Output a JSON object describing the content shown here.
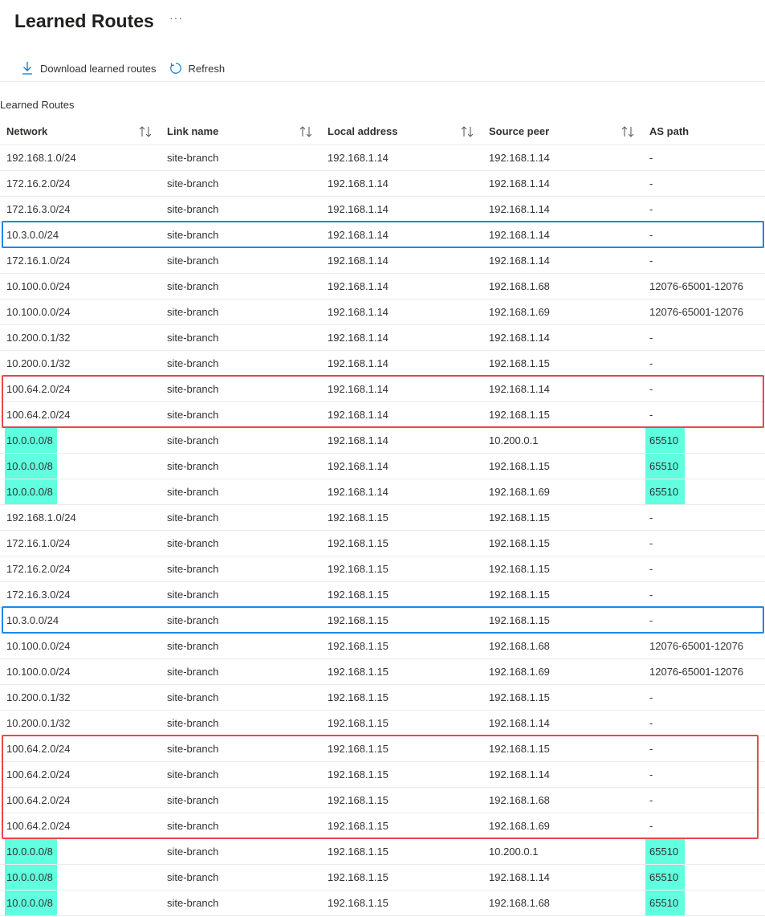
{
  "header": {
    "title": "Learned Routes",
    "more_label": "···"
  },
  "toolbar": {
    "download_label": "Download learned routes",
    "refresh_label": "Refresh"
  },
  "section_label": "Learned Routes",
  "colors": {
    "highlight": "#60ffe0",
    "blue_box": "#1e88e5",
    "red_box": "#e5484d",
    "accent": "#0078d4"
  },
  "table": {
    "columns": [
      "Network",
      "Link name",
      "Local address",
      "Source peer",
      "AS path"
    ],
    "sortable": [
      true,
      true,
      true,
      true,
      false
    ],
    "rows": [
      [
        "192.168.1.0/24",
        "site-branch",
        "192.168.1.14",
        "192.168.1.14",
        "-"
      ],
      [
        "172.16.2.0/24",
        "site-branch",
        "192.168.1.14",
        "192.168.1.14",
        "-"
      ],
      [
        "172.16.3.0/24",
        "site-branch",
        "192.168.1.14",
        "192.168.1.14",
        "-"
      ],
      [
        "10.3.0.0/24",
        "site-branch",
        "192.168.1.14",
        "192.168.1.14",
        "-"
      ],
      [
        "172.16.1.0/24",
        "site-branch",
        "192.168.1.14",
        "192.168.1.14",
        "-"
      ],
      [
        "10.100.0.0/24",
        "site-branch",
        "192.168.1.14",
        "192.168.1.68",
        "12076-65001-12076"
      ],
      [
        "10.100.0.0/24",
        "site-branch",
        "192.168.1.14",
        "192.168.1.69",
        "12076-65001-12076"
      ],
      [
        "10.200.0.1/32",
        "site-branch",
        "192.168.1.14",
        "192.168.1.14",
        "-"
      ],
      [
        "10.200.0.1/32",
        "site-branch",
        "192.168.1.14",
        "192.168.1.15",
        "-"
      ],
      [
        "100.64.2.0/24",
        "site-branch",
        "192.168.1.14",
        "192.168.1.14",
        "-"
      ],
      [
        "100.64.2.0/24",
        "site-branch",
        "192.168.1.14",
        "192.168.1.15",
        "-"
      ],
      [
        "10.0.0.0/8",
        "site-branch",
        "192.168.1.14",
        "10.200.0.1",
        "65510"
      ],
      [
        "10.0.0.0/8",
        "site-branch",
        "192.168.1.14",
        "192.168.1.15",
        "65510"
      ],
      [
        "10.0.0.0/8",
        "site-branch",
        "192.168.1.14",
        "192.168.1.69",
        "65510"
      ],
      [
        "192.168.1.0/24",
        "site-branch",
        "192.168.1.15",
        "192.168.1.15",
        "-"
      ],
      [
        "172.16.1.0/24",
        "site-branch",
        "192.168.1.15",
        "192.168.1.15",
        "-"
      ],
      [
        "172.16.2.0/24",
        "site-branch",
        "192.168.1.15",
        "192.168.1.15",
        "-"
      ],
      [
        "172.16.3.0/24",
        "site-branch",
        "192.168.1.15",
        "192.168.1.15",
        "-"
      ],
      [
        "10.3.0.0/24",
        "site-branch",
        "192.168.1.15",
        "192.168.1.15",
        "-"
      ],
      [
        "10.100.0.0/24",
        "site-branch",
        "192.168.1.15",
        "192.168.1.68",
        "12076-65001-12076"
      ],
      [
        "10.100.0.0/24",
        "site-branch",
        "192.168.1.15",
        "192.168.1.69",
        "12076-65001-12076"
      ],
      [
        "10.200.0.1/32",
        "site-branch",
        "192.168.1.15",
        "192.168.1.15",
        "-"
      ],
      [
        "10.200.0.1/32",
        "site-branch",
        "192.168.1.15",
        "192.168.1.14",
        "-"
      ],
      [
        "100.64.2.0/24",
        "site-branch",
        "192.168.1.15",
        "192.168.1.15",
        "-"
      ],
      [
        "100.64.2.0/24",
        "site-branch",
        "192.168.1.15",
        "192.168.1.14",
        "-"
      ],
      [
        "100.64.2.0/24",
        "site-branch",
        "192.168.1.15",
        "192.168.1.68",
        "-"
      ],
      [
        "100.64.2.0/24",
        "site-branch",
        "192.168.1.15",
        "192.168.1.69",
        "-"
      ],
      [
        "10.0.0.0/8",
        "site-branch",
        "192.168.1.15",
        "10.200.0.1",
        "65510"
      ],
      [
        "10.0.0.0/8",
        "site-branch",
        "192.168.1.15",
        "192.168.1.14",
        "65510"
      ],
      [
        "10.0.0.0/8",
        "site-branch",
        "192.168.1.15",
        "192.168.1.68",
        "65510"
      ]
    ],
    "highlighted_rows": [
      11,
      12,
      13,
      27,
      28,
      29
    ],
    "annotation_boxes": [
      {
        "color": "blue",
        "first_row": 3,
        "last_row": 3
      },
      {
        "color": "red",
        "first_row": 9,
        "last_row": 10
      },
      {
        "color": "blue",
        "first_row": 18,
        "last_row": 18
      },
      {
        "color": "red",
        "first_row": 23,
        "last_row": 26
      }
    ]
  }
}
